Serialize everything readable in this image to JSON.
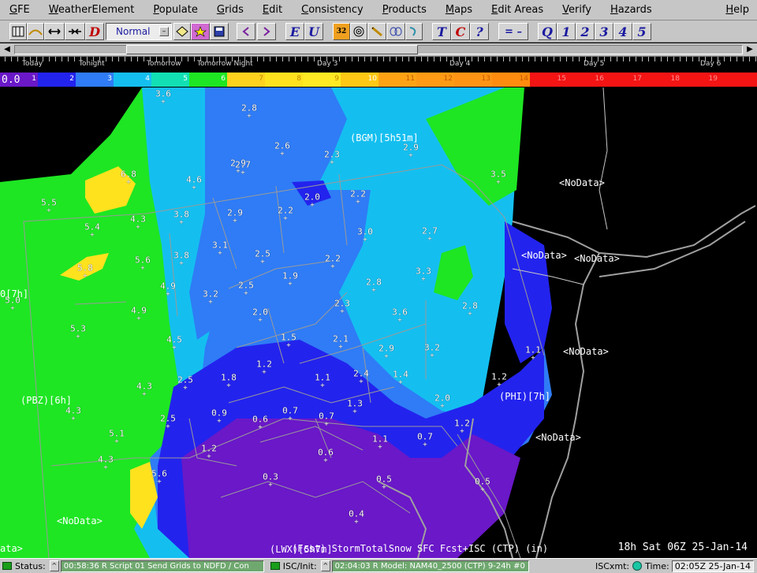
{
  "menubar": {
    "items": [
      {
        "mn": "G",
        "rest": "FE"
      },
      {
        "mn": "W",
        "rest": "eatherElement"
      },
      {
        "mn": "P",
        "rest": "opulate"
      },
      {
        "mn": "G",
        "rest": "rids"
      },
      {
        "mn": "E",
        "rest": "dit"
      },
      {
        "mn": "C",
        "rest": "onsistency"
      },
      {
        "mn": "P",
        "rest": "roducts"
      },
      {
        "mn": "M",
        "rest": "aps"
      },
      {
        "mn": "E",
        "rest": "dit Areas"
      },
      {
        "mn": "V",
        "rest": "erify"
      },
      {
        "mn": "H",
        "rest": "azards"
      }
    ],
    "help": {
      "mn": "H",
      "rest": "elp"
    }
  },
  "toolbar": {
    "mode_value": "Normal",
    "letters": {
      "d": "D",
      "e": "E",
      "u": "U",
      "t": "T",
      "c": "C",
      "q_mark": "?",
      "q": "Q",
      "n1": "1",
      "n2": "2",
      "n3": "3",
      "n4": "4",
      "n5": "5",
      "minus": "= –"
    },
    "icon32": "32"
  },
  "timebar": {
    "days": [
      "Today",
      "Tonight",
      "Tomorrow",
      "Tomorrow Night",
      "Day 3",
      "Day 4",
      "Day 5",
      "Day 6"
    ]
  },
  "colorbar": {
    "readout": "0.0",
    "segments": [
      {
        "label": "1",
        "color": "#6a18c8",
        "text": "#ffffff"
      },
      {
        "label": "2",
        "color": "#2323ee",
        "text": "#ffffff"
      },
      {
        "label": "3",
        "color": "#2f7cf6",
        "text": "#ffffff"
      },
      {
        "label": "4",
        "color": "#14bff0",
        "text": "#ffffff"
      },
      {
        "label": "5",
        "color": "#12e0b4",
        "text": "#ffffff"
      },
      {
        "label": "6",
        "color": "#1ee623",
        "text": "#ffffff"
      },
      {
        "label": "7",
        "color": "#ffd21e",
        "text": "#c08a00"
      },
      {
        "label": "8",
        "color": "#ffe21e",
        "text": "#c08a00"
      },
      {
        "label": "9",
        "color": "#ffea23",
        "text": "#c08a00"
      },
      {
        "label": "10",
        "color": "#ffc814",
        "text": "#ffffff"
      },
      {
        "label": "11",
        "color": "#ffa314",
        "text": "#c55a00"
      },
      {
        "label": "12",
        "color": "#ff9a14",
        "text": "#c55a00"
      },
      {
        "label": "13",
        "color": "#ff9414",
        "text": "#c55a00"
      },
      {
        "label": "14",
        "color": "#ff8c0e",
        "text": "#c55a00"
      },
      {
        "label": "15",
        "color": "#f41414",
        "text": "#ff9090"
      },
      {
        "label": "16",
        "color": "#f41414",
        "text": "#ff9090"
      },
      {
        "label": "17",
        "color": "#f41414",
        "text": "#ff9090"
      },
      {
        "label": "18",
        "color": "#f41414",
        "text": "#ff9090"
      },
      {
        "label": "19",
        "color": "#f41414",
        "text": "#ff9090"
      },
      {
        "label": "",
        "color": "#f41414",
        "text": "#ff9090"
      }
    ]
  },
  "map": {
    "sites": [
      {
        "name": "BGM-label",
        "text": "(BGM)[5h51m]"
      },
      {
        "name": "PBZ-label",
        "text": "(PBZ)[6h]"
      },
      {
        "name": "PHI-label",
        "text": "(PHI)[7h]"
      },
      {
        "name": "LWX-label",
        "text": "(LWX)[5h7m]"
      },
      {
        "name": "left-7h-label",
        "text": "0[7h]"
      },
      {
        "name": "nodata-1",
        "text": "<NoData>"
      },
      {
        "name": "nodata-2",
        "text": "<NoData>"
      },
      {
        "name": "nodata-3",
        "text": "<NoData>"
      },
      {
        "name": "nodata-4",
        "text": "<NoData>"
      },
      {
        "name": "nodata-5",
        "text": "<NoData>"
      },
      {
        "name": "nodata-6",
        "text": "<NoData>"
      },
      {
        "name": "left-data-label",
        "text": "ata>"
      }
    ],
    "values": [
      "3.6",
      "2.8",
      "2.6",
      "2.3",
      "2.9",
      "2.9",
      "2.7",
      "3.5",
      "6.8",
      "4.6",
      "2.0",
      "2.2",
      "5.5",
      "4.3",
      "3.8",
      "2.9",
      "2.2",
      "3.0",
      "2.7",
      "5.4",
      "3.1",
      "2.5",
      "2.2",
      "5.8",
      "5.6",
      "3.8",
      "1.9",
      "2.8",
      "3.3",
      "4.9",
      "3.2",
      "2.5",
      "2.3",
      "3.6",
      "2.8",
      "5.0",
      "4.9",
      "2.0",
      "5.3",
      "1.5",
      "2.1",
      "4.5",
      "2.9",
      "3.2",
      "1.1",
      "1.2",
      "1.8",
      "2.4",
      "1.4",
      "1.2",
      "1.1",
      "4.3",
      "2.5",
      "1.3",
      "2.0",
      "4.3",
      "0.9",
      "0.6",
      "0.7",
      "0.7",
      "2.5",
      "1.2",
      "5.1",
      "1.1",
      "0.7",
      "1.2",
      "4.3",
      "0.6",
      "5.6",
      "0.3",
      "0.5",
      "0.5",
      "0.4"
    ],
    "caption": "(Fcst) StormTotalSnow SFC Fcst+ISC (CTP)  (in)",
    "time": "18h Sat 06Z 25-Jan-14"
  },
  "statusbar": {
    "status_label": "Status:",
    "status_msg": "00:58:36 R Script 01 Send Grids to NDFD / Con",
    "isc_label": "ISC/Init:",
    "isc_msg": "02:04:03 R Model: NAM40_2500 (CTP) 9-24h #0",
    "iscxmt_label": "ISCxmt:",
    "time_label": "Time:",
    "time_value": "02:05Z 25-Jan-14"
  }
}
